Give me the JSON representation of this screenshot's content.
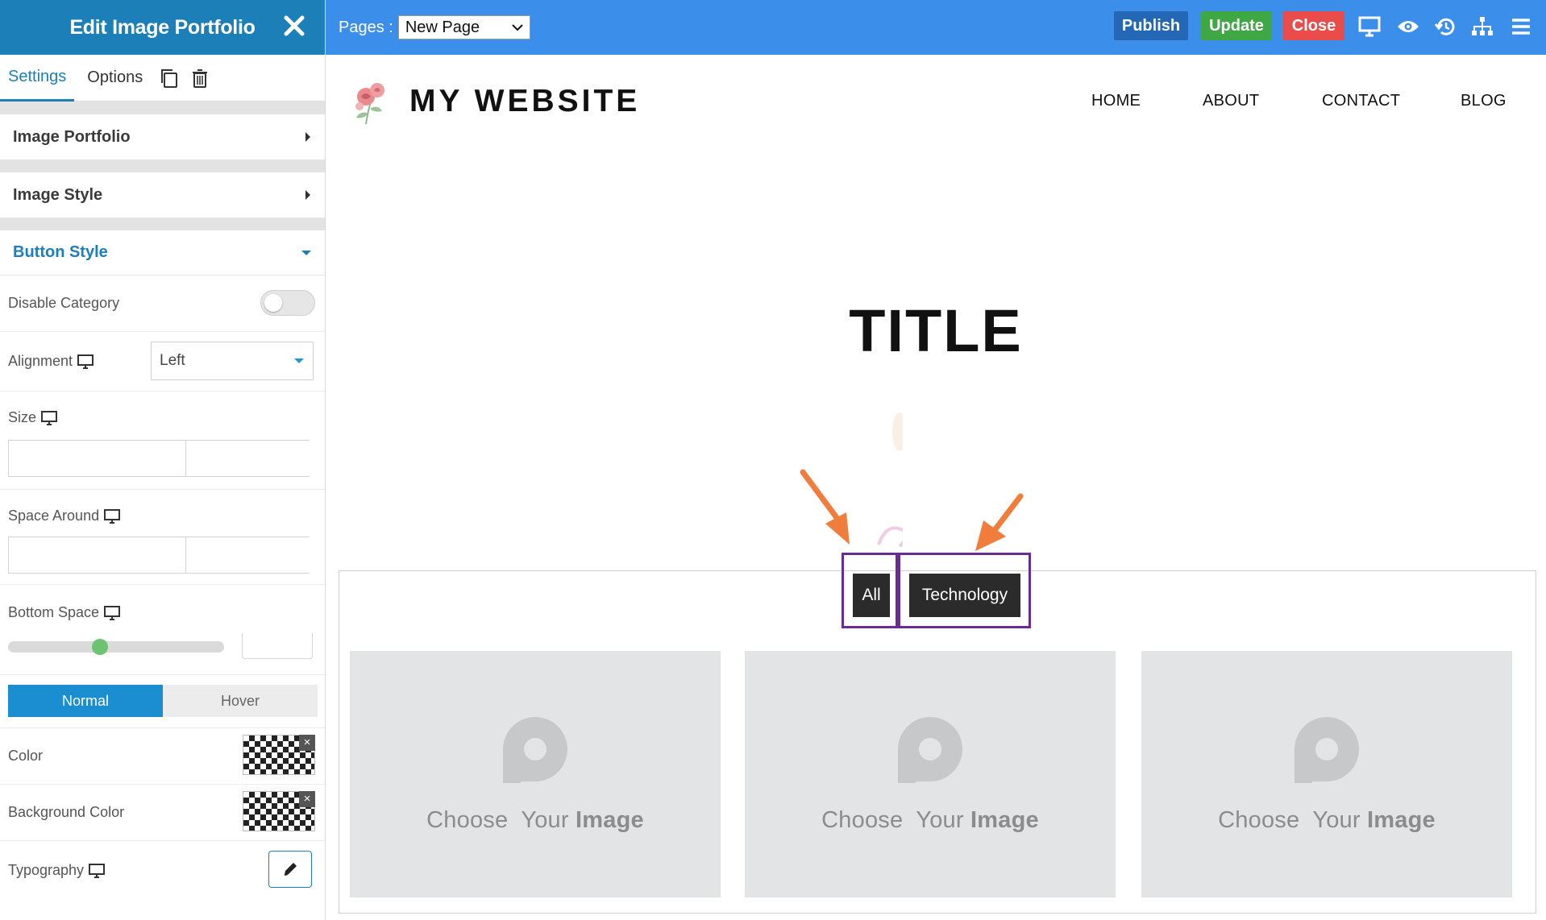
{
  "panel": {
    "title": "Edit Image Portfolio",
    "tabs": [
      "Settings",
      "Options"
    ],
    "sections": {
      "image_portfolio": "Image Portfolio",
      "image_style": "Image Style",
      "button_style": "Button Style"
    },
    "fields": {
      "disable_category": "Disable Category",
      "alignment": "Alignment",
      "alignment_value": "Left",
      "size": "Size",
      "space_around": "Space Around",
      "bottom_space": "Bottom Space",
      "bottom_space_level": 0.42,
      "state_normal": "Normal",
      "state_hover": "Hover",
      "color": "Color",
      "background_color": "Background Color",
      "typography": "Typography"
    }
  },
  "topbar": {
    "pages_label": "Pages :",
    "pages_value": "New Page",
    "publish": "Publish",
    "update": "Update",
    "close": "Close",
    "colors": {
      "bar": "#3b8eea",
      "publish": "#2367b5",
      "update": "#3fa845",
      "close": "#ea4b4b"
    }
  },
  "site": {
    "name": "MY WEBSITE",
    "nav": [
      "HOME",
      "ABOUT",
      "CONTACT",
      "BLOG"
    ],
    "page_title": "TITLE"
  },
  "portfolio": {
    "filters": [
      "All",
      "Technology"
    ],
    "placeholder": {
      "part1": "Choose",
      "part2": "Your",
      "part3": "Image"
    },
    "highlight_color": "#6a2c91",
    "arrow_color": "#f07d3b"
  }
}
